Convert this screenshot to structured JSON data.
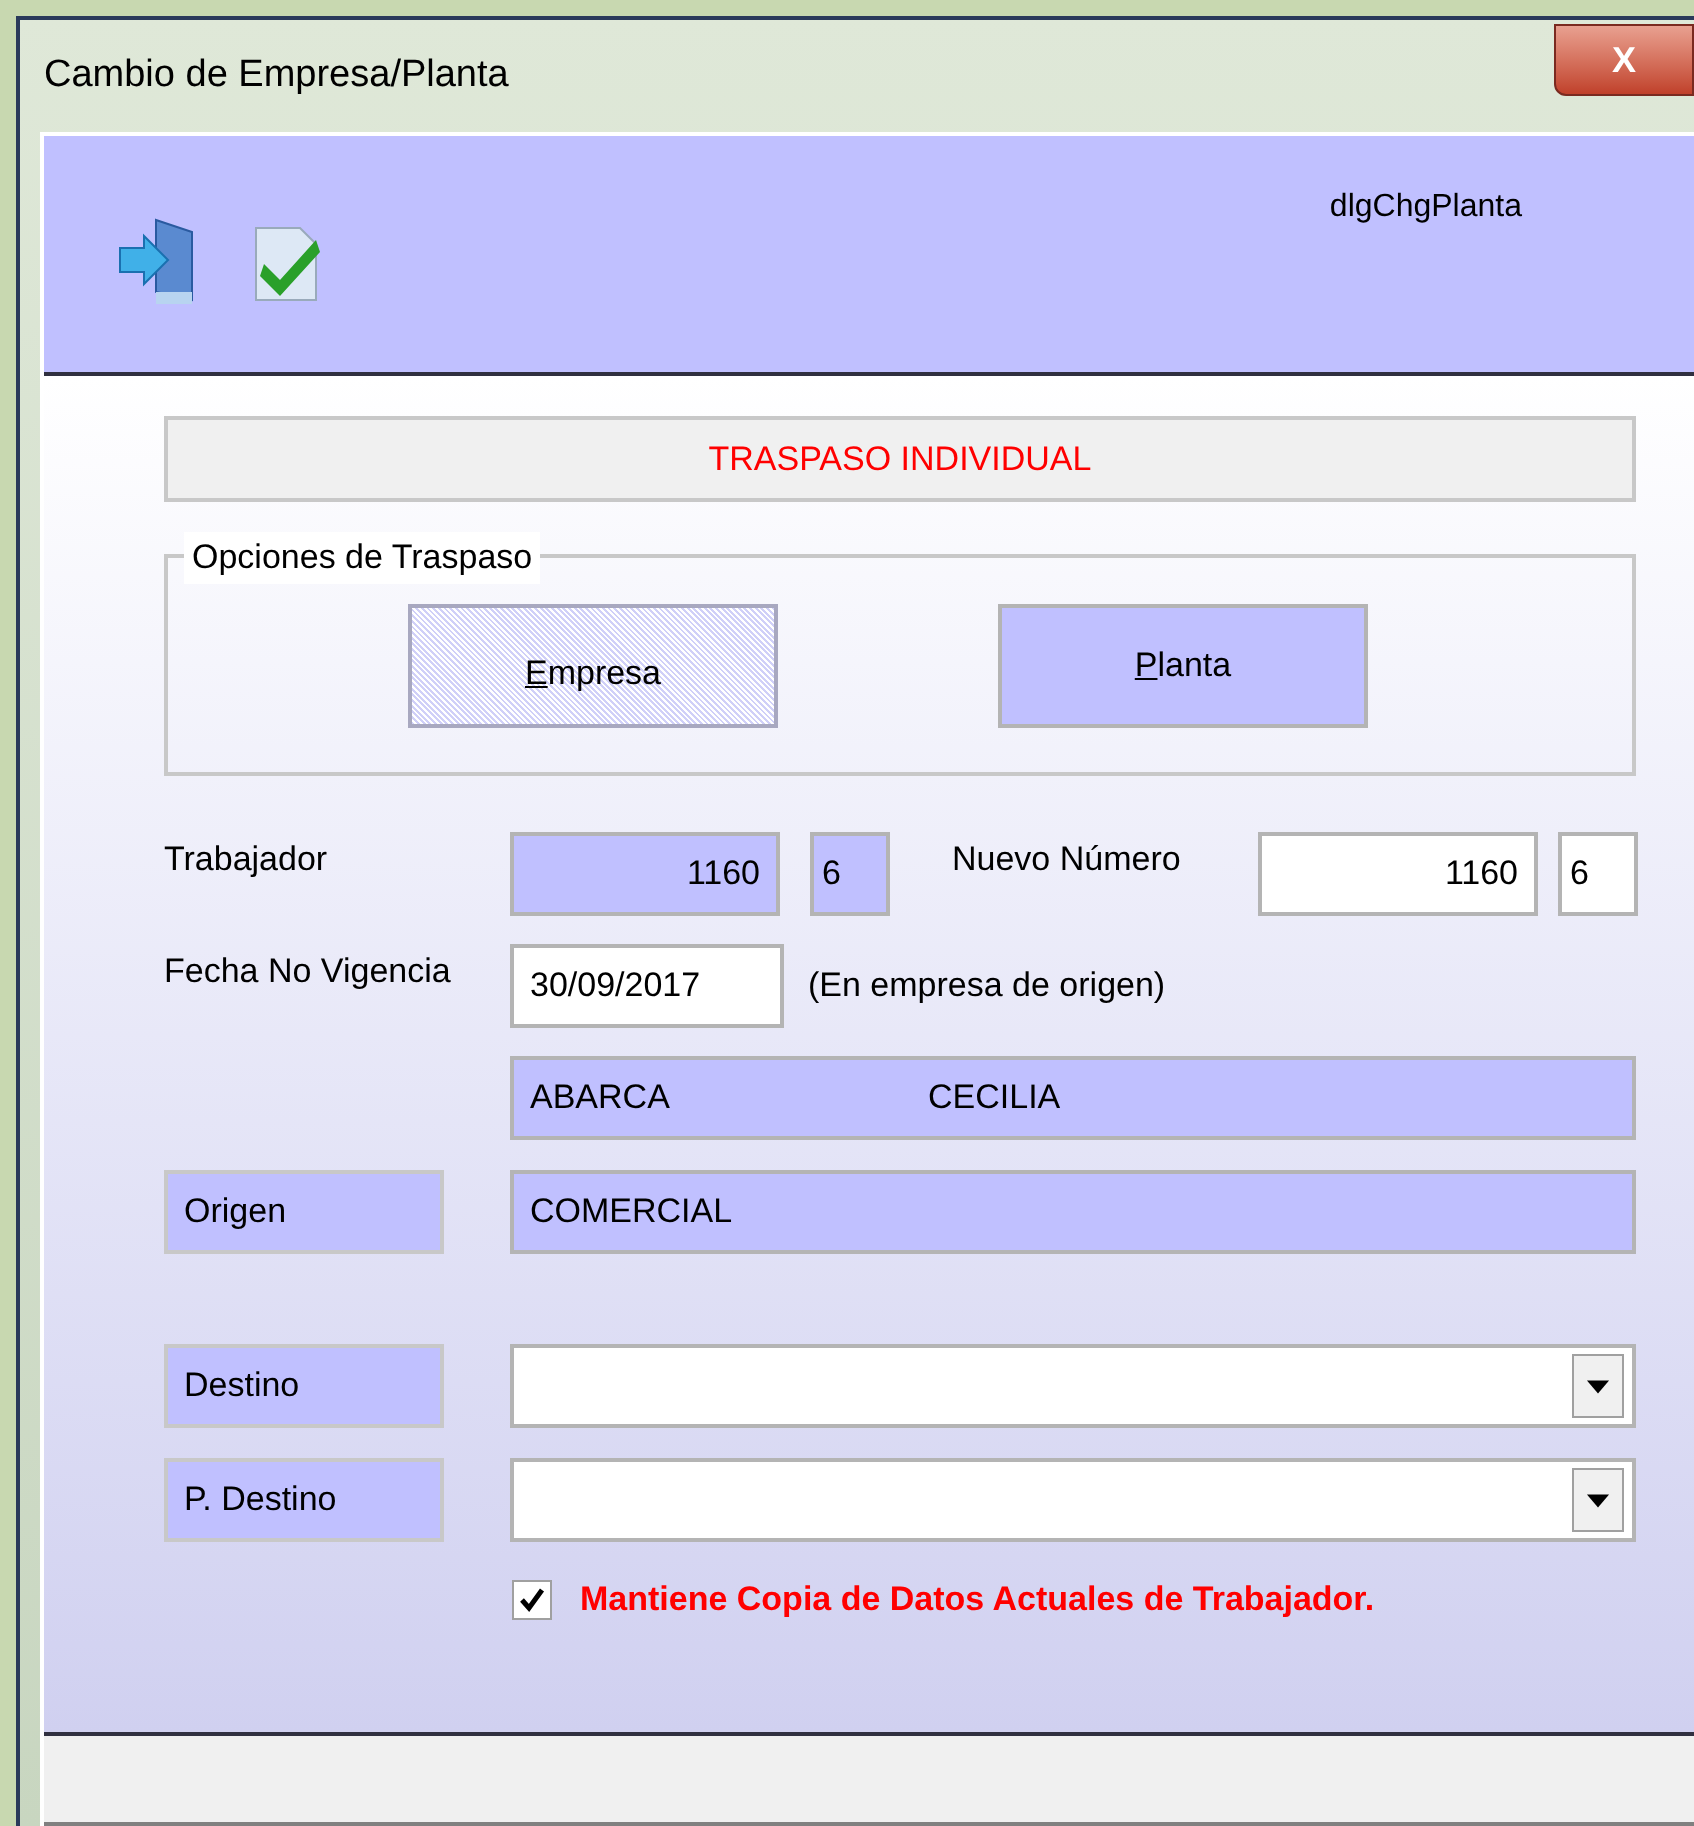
{
  "window": {
    "title": "Cambio de Empresa/Planta",
    "close": "X"
  },
  "toolbar": {
    "form_name": "dlgChgPlanta"
  },
  "banner": "TRASPASO INDIVIDUAL",
  "options": {
    "legend": "Opciones de Traspaso",
    "buttons": [
      {
        "label": "Empresa",
        "selected": true
      },
      {
        "label": "Planta",
        "selected": false
      }
    ]
  },
  "trabajador": {
    "label": "Trabajador",
    "number": "1160",
    "suffix": "6"
  },
  "nuevo_numero": {
    "label": "Nuevo Número",
    "number": "1160",
    "suffix": "6"
  },
  "fecha": {
    "label": "Fecha No Vigencia",
    "value": "30/09/2017",
    "note": "(En empresa de origen)"
  },
  "name": {
    "surname": "ABARCA",
    "given": "CECILIA"
  },
  "origen": {
    "label": "Origen",
    "value": "COMERCIAL"
  },
  "destino": {
    "label": "Destino"
  },
  "p_destino": {
    "label": "P. Destino"
  },
  "keep_copy": {
    "label": "Mantiene Copia de Datos Actuales de Trabajador.",
    "checked": true
  }
}
